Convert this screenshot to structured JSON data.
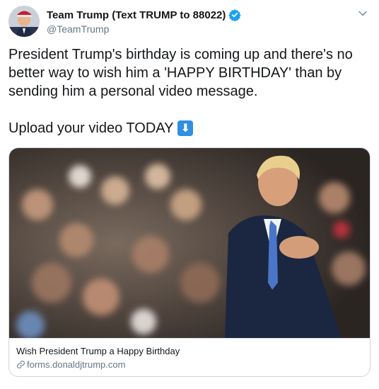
{
  "author": {
    "display_name": "Team Trump (Text TRUMP to 88022)",
    "handle": "@TeamTrump",
    "verified": true
  },
  "icons": {
    "verified": "verified-badge-icon",
    "menu": "chevron-down-icon",
    "link": "link-icon",
    "arrow": "down-arrow-emoji"
  },
  "tweet": {
    "text": "President Trump's birthday is coming up and there's no better way to wish him a 'HAPPY BIRTHDAY' than by sending him a personal video message.",
    "upload_line": "Upload your video TODAY",
    "emoji": "⬇"
  },
  "card": {
    "title": "Wish President Trump a Happy Birthday",
    "domain": "forms.donaldjtrump.com"
  },
  "colors": {
    "accent": "#1da1f2",
    "secondary_text": "#657786",
    "border": "#ccd6dd",
    "emoji_bg": "#2f8fe2"
  }
}
